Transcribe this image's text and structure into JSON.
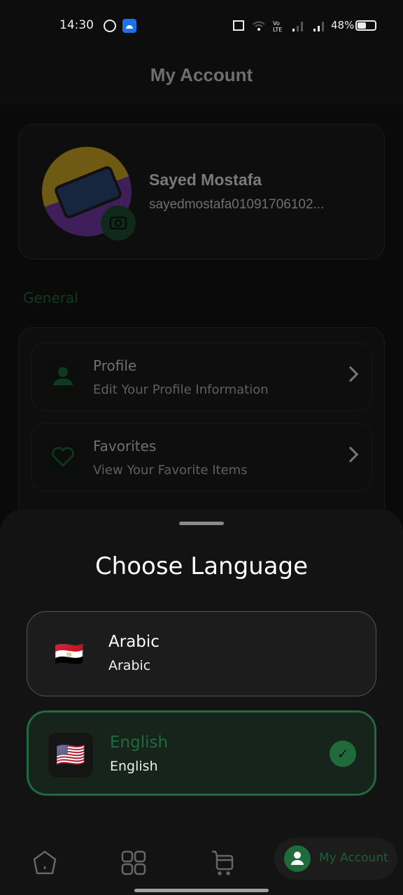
{
  "status_bar": {
    "time": "14:30",
    "battery": "48%",
    "battery_level": 0.48
  },
  "app_bar": {
    "title": "My Account"
  },
  "profile": {
    "name": "Sayed Mostafa",
    "email": "sayedmostafa01091706102..."
  },
  "general": {
    "title": "General",
    "items": [
      {
        "title": "Profile",
        "subtitle": "Edit Your Profile Information",
        "icon": "person-icon"
      },
      {
        "title": "Favorites",
        "subtitle": "View Your Favorite Items",
        "icon": "heart-icon"
      }
    ]
  },
  "sheet": {
    "title": "Choose Language",
    "options": [
      {
        "title": "Arabic",
        "subtitle": "Arabic",
        "flag": "🇪🇬",
        "selected": false
      },
      {
        "title": "English",
        "subtitle": "English",
        "flag": "🇺🇸",
        "selected": true
      }
    ]
  },
  "bottom_nav": {
    "active_label": "My Account",
    "accent": "#1f6b3c"
  }
}
